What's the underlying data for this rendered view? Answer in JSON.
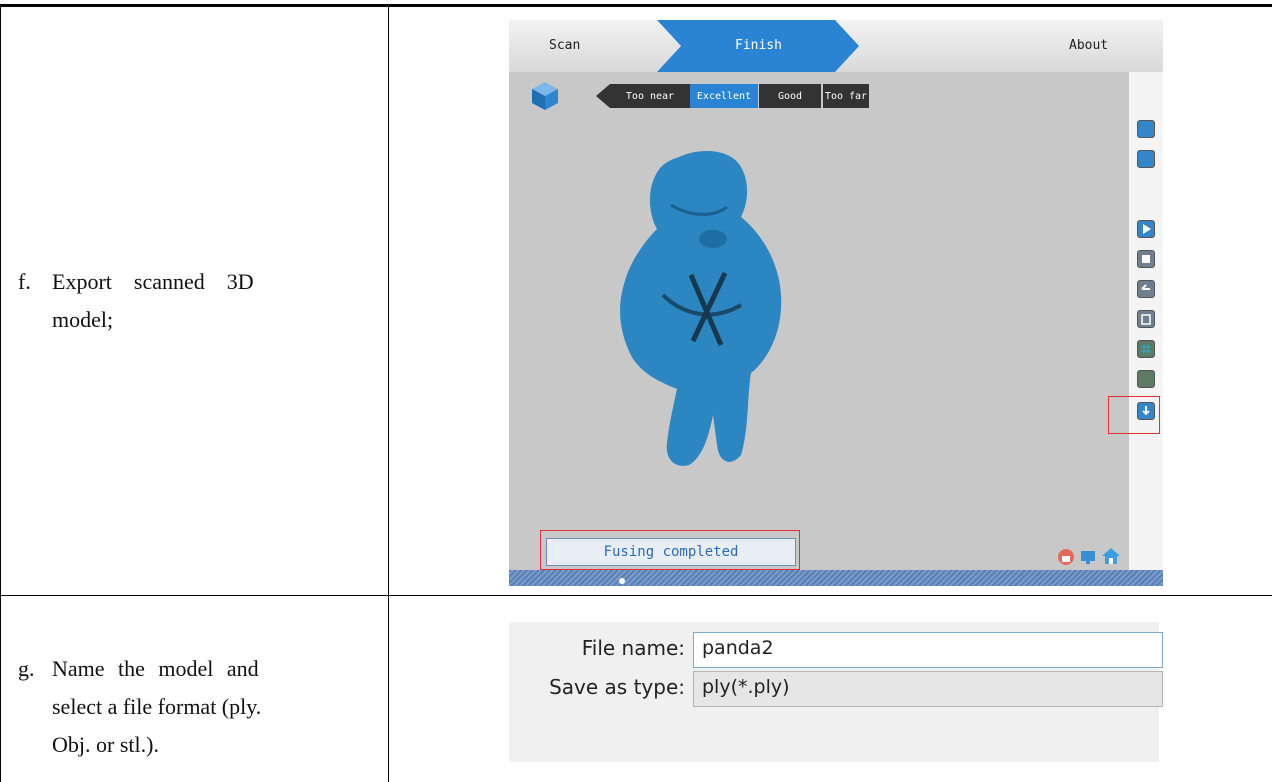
{
  "steps": [
    {
      "num": "f.",
      "line1": "Export    scanned    3D",
      "line2": "model;"
    },
    {
      "num": "g.",
      "line1": "Name the model and",
      "line2": "select a file format (ply.",
      "line3": "Obj. or stl.)."
    }
  ],
  "app": {
    "tabs": {
      "scan": "Scan",
      "finish": "Finish",
      "about": "About"
    },
    "quality": [
      "Too near",
      "Excellent",
      "Good",
      "Too far"
    ],
    "selected_quality": "Excellent",
    "status": "Fusing completed",
    "icons": {
      "logo": "blue-cube-icon",
      "sidebar": [
        "folder-icon",
        "open-folder-icon",
        "play-icon",
        "stop-icon",
        "undo-icon",
        "trash-icon",
        "grid-icon",
        "texture-icon",
        "export-icon"
      ],
      "corner": [
        "lock-icon",
        "monitor-icon",
        "home-icon"
      ]
    },
    "colors": {
      "accent": "#2a83d3",
      "model": "#2b86c1",
      "highlight": "#e03030"
    }
  },
  "dialog": {
    "file_name_label": "File name:",
    "file_name_value": "panda2",
    "save_type_label": "Save as type:",
    "save_type_value": "ply(*.ply)"
  }
}
